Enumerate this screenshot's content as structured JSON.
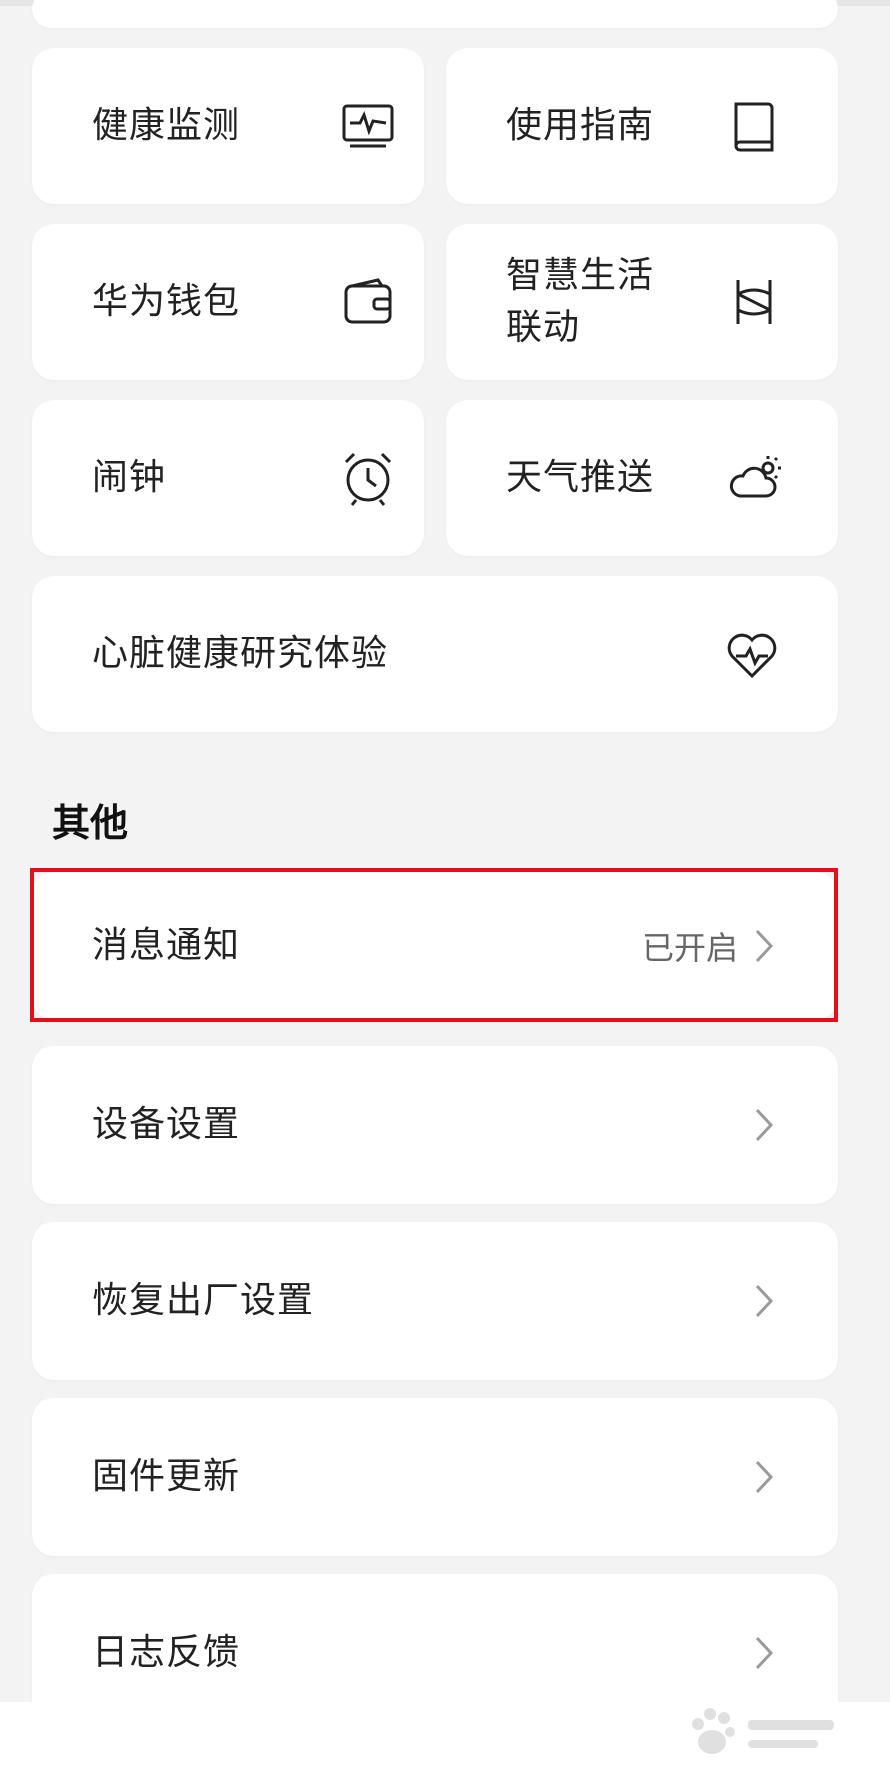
{
  "features": {
    "health_monitor": "健康监测",
    "user_guide": "使用指南",
    "huawei_wallet": "华为钱包",
    "smart_life_line1": "智慧生活",
    "smart_life_line2": "联动",
    "alarm": "闹钟",
    "weather_push": "天气推送",
    "heart_study": "心脏健康研究体验"
  },
  "other": {
    "section_title": "其他",
    "rows": [
      {
        "label": "消息通知",
        "value": "已开启"
      },
      {
        "label": "设备设置",
        "value": ""
      },
      {
        "label": "恢复出厂设置",
        "value": ""
      },
      {
        "label": "固件更新",
        "value": ""
      },
      {
        "label": "日志反馈",
        "value": ""
      }
    ]
  },
  "colors": {
    "highlight": "#e3101a",
    "background": "#f3f3f3",
    "card": "#ffffff"
  }
}
